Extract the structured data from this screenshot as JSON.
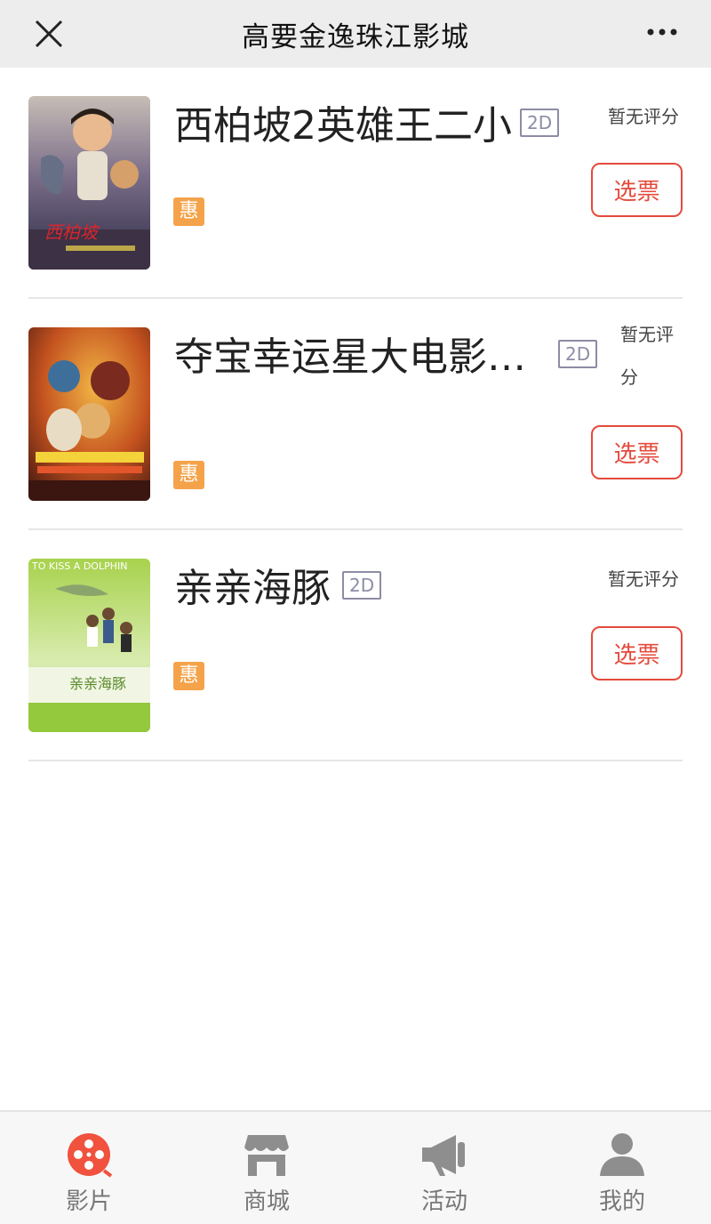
{
  "header": {
    "title": "高要金逸珠江影城"
  },
  "movies": [
    {
      "name": "西柏坡2英雄王二小",
      "format": "2D",
      "badge": "惠",
      "score_text": "暂无评分",
      "buy_label": "选票"
    },
    {
      "name": "夺宝幸运星大电影…",
      "format": "2D",
      "badge": "惠",
      "score_text_line1": "暂无评",
      "score_text_line2": "分",
      "buy_label": "选票"
    },
    {
      "name": "亲亲海豚",
      "format": "2D",
      "badge": "惠",
      "score_text": "暂无评分",
      "buy_label": "选票"
    }
  ],
  "posters": {
    "poster2_text": "TO KISS A DOLPHIN",
    "poster2_caption": "亲亲海豚"
  },
  "tabbar": {
    "items": [
      {
        "label": "影片",
        "icon": "film-reel-icon",
        "active": true
      },
      {
        "label": "商城",
        "icon": "shop-icon",
        "active": false
      },
      {
        "label": "活动",
        "icon": "megaphone-icon",
        "active": false
      },
      {
        "label": "我的",
        "icon": "user-icon",
        "active": false
      }
    ]
  },
  "colors": {
    "accent": "#e44a3c",
    "badge": "#f4a34a",
    "tag": "#8c8ca6"
  }
}
